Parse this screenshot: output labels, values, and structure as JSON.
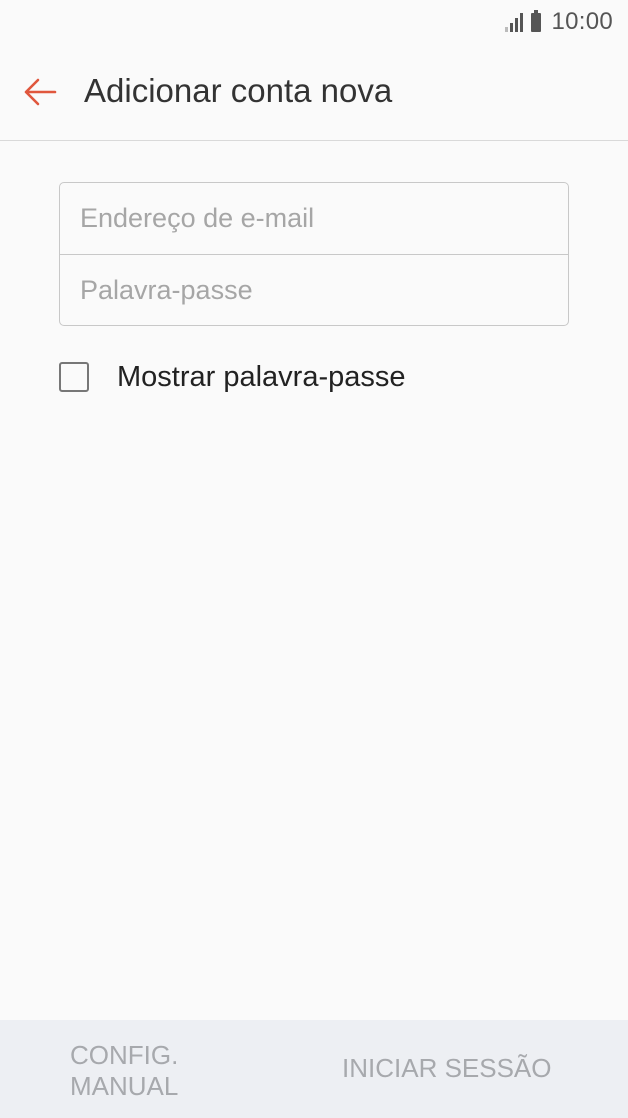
{
  "status_bar": {
    "time": "10:00"
  },
  "header": {
    "title": "Adicionar conta nova",
    "back_icon": "arrow-left-icon",
    "accent_color": "#e0573d"
  },
  "form": {
    "email_placeholder": "Endereço de e-mail",
    "email_value": "",
    "password_placeholder": "Palavra-passe",
    "password_value": "",
    "show_password_label": "Mostrar palavra-passe",
    "show_password_checked": false
  },
  "bottom_bar": {
    "manual_setup_line1": "CONFIG.",
    "manual_setup_line2": "MANUAL",
    "sign_in_label": "INICIAR SESSÃO"
  }
}
